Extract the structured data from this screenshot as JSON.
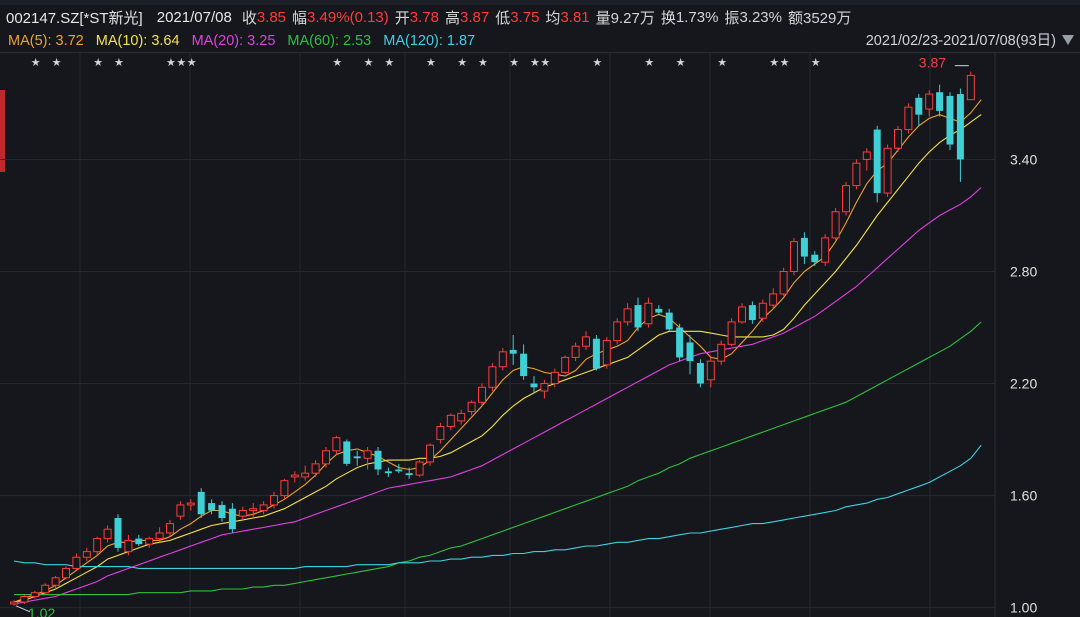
{
  "header": {
    "code_name": "002147.SZ[*ST新光]",
    "date": "2021/07/08",
    "close_label": "收",
    "close": "3.85",
    "change_label": "幅",
    "change": "3.49%(0.13)",
    "open_label": "开",
    "open": "3.78",
    "high_label": "高",
    "high": "3.87",
    "low_label": "低",
    "low": "3.75",
    "avg_label": "均",
    "avg": "3.81",
    "volume_label": "量",
    "volume": "9.27万",
    "turnover_label": "换",
    "turnover": "1.73%",
    "amplitude_label": "振",
    "amplitude": "3.23%",
    "amount_label": "额",
    "amount": "3529万"
  },
  "ma_legend": [
    {
      "text": "MA(5): 3.72",
      "color": "#f0a030"
    },
    {
      "text": "MA(10): 3.64",
      "color": "#f5e14a"
    },
    {
      "text": "MA(20): 3.25",
      "color": "#e040e0"
    },
    {
      "text": "MA(60): 2.53",
      "color": "#30c040"
    },
    {
      "text": "MA(120): 1.87",
      "color": "#40d0e0"
    }
  ],
  "date_range": "2021/02/23-2021/07/08(93日)",
  "chart_data": {
    "type": "candlestick",
    "ylim": [
      0.95,
      3.97
    ],
    "yticks": [
      "3.40",
      "2.80",
      "2.20",
      "1.60",
      "1.00"
    ],
    "ytick_values": [
      3.4,
      2.8,
      2.2,
      1.6,
      1.0
    ],
    "high_marker": "3.87",
    "low_marker": "1.02",
    "star_slots": [
      2,
      4,
      8,
      10,
      15,
      16,
      17,
      31,
      34,
      36,
      40,
      43,
      45,
      48,
      50,
      51,
      56,
      61,
      64,
      68,
      73,
      74,
      77
    ],
    "colors": {
      "up": "#ff3b3b",
      "down": "#3fd0d6"
    },
    "candles": [
      [
        1.02,
        1.04,
        1.01,
        1.03
      ],
      [
        1.03,
        1.07,
        1.02,
        1.06
      ],
      [
        1.06,
        1.09,
        1.05,
        1.08
      ],
      [
        1.08,
        1.13,
        1.07,
        1.12
      ],
      [
        1.12,
        1.17,
        1.1,
        1.16
      ],
      [
        1.16,
        1.22,
        1.15,
        1.21
      ],
      [
        1.21,
        1.29,
        1.2,
        1.27
      ],
      [
        1.27,
        1.32,
        1.25,
        1.3
      ],
      [
        1.3,
        1.38,
        1.28,
        1.37
      ],
      [
        1.37,
        1.44,
        1.35,
        1.42
      ],
      [
        1.48,
        1.5,
        1.3,
        1.32
      ],
      [
        1.3,
        1.39,
        1.28,
        1.36
      ],
      [
        1.37,
        1.39,
        1.33,
        1.34
      ],
      [
        1.34,
        1.38,
        1.32,
        1.37
      ],
      [
        1.37,
        1.43,
        1.35,
        1.4
      ],
      [
        1.4,
        1.47,
        1.38,
        1.45
      ],
      [
        1.49,
        1.57,
        1.47,
        1.55
      ],
      [
        1.55,
        1.58,
        1.52,
        1.56
      ],
      [
        1.62,
        1.64,
        1.48,
        1.5
      ],
      [
        1.56,
        1.58,
        1.5,
        1.52
      ],
      [
        1.55,
        1.57,
        1.46,
        1.48
      ],
      [
        1.53,
        1.56,
        1.4,
        1.42
      ],
      [
        1.49,
        1.54,
        1.47,
        1.52
      ],
      [
        1.52,
        1.56,
        1.48,
        1.53
      ],
      [
        1.52,
        1.57,
        1.5,
        1.55
      ],
      [
        1.55,
        1.62,
        1.53,
        1.6
      ],
      [
        1.6,
        1.69,
        1.58,
        1.68
      ],
      [
        1.7,
        1.73,
        1.67,
        1.71
      ],
      [
        1.7,
        1.76,
        1.68,
        1.72
      ],
      [
        1.72,
        1.79,
        1.7,
        1.77
      ],
      [
        1.77,
        1.86,
        1.75,
        1.84
      ],
      [
        1.84,
        1.92,
        1.82,
        1.91
      ],
      [
        1.89,
        1.9,
        1.76,
        1.77
      ],
      [
        1.81,
        1.84,
        1.76,
        1.8
      ],
      [
        1.8,
        1.86,
        1.74,
        1.84
      ],
      [
        1.84,
        1.86,
        1.71,
        1.74
      ],
      [
        1.73,
        1.75,
        1.7,
        1.72
      ],
      [
        1.74,
        1.77,
        1.72,
        1.73
      ],
      [
        1.72,
        1.75,
        1.69,
        1.71
      ],
      [
        1.71,
        1.79,
        1.7,
        1.78
      ],
      [
        1.78,
        1.88,
        1.76,
        1.87
      ],
      [
        1.9,
        1.99,
        1.88,
        1.97
      ],
      [
        1.97,
        2.04,
        1.95,
        2.03
      ],
      [
        2.0,
        2.06,
        1.98,
        2.04
      ],
      [
        2.05,
        2.11,
        2.03,
        2.1
      ],
      [
        2.1,
        2.2,
        2.08,
        2.18
      ],
      [
        2.18,
        2.31,
        2.16,
        2.29
      ],
      [
        2.29,
        2.39,
        2.27,
        2.37
      ],
      [
        2.38,
        2.46,
        2.3,
        2.36
      ],
      [
        2.36,
        2.41,
        2.22,
        2.24
      ],
      [
        2.2,
        2.24,
        2.15,
        2.18
      ],
      [
        2.16,
        2.22,
        2.12,
        2.2
      ],
      [
        2.2,
        2.28,
        2.18,
        2.26
      ],
      [
        2.26,
        2.35,
        2.25,
        2.34
      ],
      [
        2.34,
        2.42,
        2.32,
        2.4
      ],
      [
        2.4,
        2.48,
        2.38,
        2.45
      ],
      [
        2.44,
        2.46,
        2.27,
        2.28
      ],
      [
        2.3,
        2.45,
        2.28,
        2.43
      ],
      [
        2.43,
        2.55,
        2.41,
        2.53
      ],
      [
        2.53,
        2.63,
        2.51,
        2.6
      ],
      [
        2.62,
        2.66,
        2.48,
        2.5
      ],
      [
        2.52,
        2.66,
        2.5,
        2.63
      ],
      [
        2.6,
        2.62,
        2.57,
        2.58
      ],
      [
        2.58,
        2.6,
        2.48,
        2.49
      ],
      [
        2.5,
        2.52,
        2.32,
        2.34
      ],
      [
        2.42,
        2.46,
        2.25,
        2.32
      ],
      [
        2.31,
        2.33,
        2.18,
        2.2
      ],
      [
        2.22,
        2.35,
        2.18,
        2.32
      ],
      [
        2.32,
        2.43,
        2.3,
        2.41
      ],
      [
        2.41,
        2.55,
        2.4,
        2.53
      ],
      [
        2.53,
        2.63,
        2.52,
        2.61
      ],
      [
        2.62,
        2.64,
        2.52,
        2.54
      ],
      [
        2.55,
        2.65,
        2.53,
        2.63
      ],
      [
        2.62,
        2.71,
        2.6,
        2.68
      ],
      [
        2.68,
        2.82,
        2.67,
        2.8
      ],
      [
        2.8,
        2.98,
        2.78,
        2.96
      ],
      [
        2.98,
        3.01,
        2.84,
        2.88
      ],
      [
        2.89,
        2.91,
        2.83,
        2.85
      ],
      [
        2.85,
        3.0,
        2.83,
        2.98
      ],
      [
        2.98,
        3.14,
        2.97,
        3.12
      ],
      [
        3.12,
        3.28,
        3.1,
        3.26
      ],
      [
        3.26,
        3.4,
        3.24,
        3.38
      ],
      [
        3.4,
        3.46,
        3.34,
        3.44
      ],
      [
        3.56,
        3.58,
        3.17,
        3.22
      ],
      [
        3.22,
        3.48,
        3.2,
        3.46
      ],
      [
        3.46,
        3.58,
        3.44,
        3.56
      ],
      [
        3.56,
        3.7,
        3.54,
        3.68
      ],
      [
        3.73,
        3.75,
        3.58,
        3.64
      ],
      [
        3.67,
        3.77,
        3.63,
        3.75
      ],
      [
        3.76,
        3.8,
        3.63,
        3.66
      ],
      [
        3.74,
        3.76,
        3.45,
        3.48
      ],
      [
        3.75,
        3.78,
        3.28,
        3.4
      ],
      [
        3.72,
        3.87,
        3.75,
        3.85
      ]
    ],
    "ma_series": [
      {
        "name": "MA(5)",
        "color": "#f0a030",
        "values": [
          1.03,
          1.05,
          1.07,
          1.09,
          1.12,
          1.16,
          1.2,
          1.24,
          1.28,
          1.33,
          1.35,
          1.35,
          1.36,
          1.36,
          1.36,
          1.38,
          1.42,
          1.45,
          1.49,
          1.52,
          1.52,
          1.5,
          1.49,
          1.5,
          1.52,
          1.55,
          1.58,
          1.62,
          1.66,
          1.71,
          1.77,
          1.82,
          1.84,
          1.85,
          1.83,
          1.81,
          1.78,
          1.75,
          1.74,
          1.75,
          1.79,
          1.84,
          1.9,
          1.96,
          2.02,
          2.08,
          2.15,
          2.22,
          2.27,
          2.29,
          2.28,
          2.26,
          2.25,
          2.24,
          2.27,
          2.33,
          2.36,
          2.38,
          2.4,
          2.43,
          2.5,
          2.55,
          2.57,
          2.55,
          2.5,
          2.45,
          2.4,
          2.34,
          2.33,
          2.36,
          2.42,
          2.48,
          2.55,
          2.6,
          2.66,
          2.74,
          2.8,
          2.84,
          2.88,
          2.96,
          3.06,
          3.17,
          3.27,
          3.34,
          3.38,
          3.45,
          3.52,
          3.58,
          3.62,
          3.64,
          3.62,
          3.6,
          3.65,
          3.72
        ]
      },
      {
        "name": "MA(10)",
        "color": "#f5e14a",
        "values": [
          1.03,
          1.04,
          1.06,
          1.08,
          1.1,
          1.13,
          1.16,
          1.19,
          1.22,
          1.26,
          1.28,
          1.3,
          1.32,
          1.34,
          1.35,
          1.36,
          1.38,
          1.4,
          1.42,
          1.44,
          1.45,
          1.46,
          1.47,
          1.48,
          1.49,
          1.51,
          1.53,
          1.56,
          1.59,
          1.62,
          1.65,
          1.69,
          1.72,
          1.75,
          1.77,
          1.78,
          1.79,
          1.79,
          1.79,
          1.8,
          1.8,
          1.81,
          1.83,
          1.86,
          1.89,
          1.92,
          1.97,
          2.03,
          2.08,
          2.12,
          2.15,
          2.18,
          2.2,
          2.22,
          2.24,
          2.26,
          2.28,
          2.3,
          2.32,
          2.34,
          2.38,
          2.42,
          2.46,
          2.48,
          2.48,
          2.48,
          2.48,
          2.47,
          2.46,
          2.45,
          2.45,
          2.45,
          2.45,
          2.46,
          2.49,
          2.55,
          2.62,
          2.68,
          2.74,
          2.8,
          2.87,
          2.94,
          3.02,
          3.1,
          3.17,
          3.24,
          3.31,
          3.38,
          3.44,
          3.49,
          3.53,
          3.56,
          3.6,
          3.64
        ]
      },
      {
        "name": "MA(20)",
        "color": "#e040e0",
        "values": [
          1.02,
          1.03,
          1.04,
          1.05,
          1.06,
          1.08,
          1.1,
          1.12,
          1.14,
          1.17,
          1.19,
          1.21,
          1.23,
          1.25,
          1.27,
          1.29,
          1.31,
          1.33,
          1.35,
          1.37,
          1.39,
          1.4,
          1.41,
          1.42,
          1.43,
          1.44,
          1.45,
          1.46,
          1.48,
          1.5,
          1.52,
          1.54,
          1.56,
          1.58,
          1.6,
          1.62,
          1.64,
          1.65,
          1.66,
          1.67,
          1.68,
          1.69,
          1.7,
          1.72,
          1.74,
          1.76,
          1.79,
          1.82,
          1.85,
          1.88,
          1.91,
          1.94,
          1.97,
          2.0,
          2.03,
          2.06,
          2.09,
          2.12,
          2.15,
          2.18,
          2.21,
          2.24,
          2.27,
          2.3,
          2.32,
          2.34,
          2.36,
          2.37,
          2.38,
          2.39,
          2.4,
          2.41,
          2.43,
          2.45,
          2.47,
          2.5,
          2.53,
          2.56,
          2.6,
          2.64,
          2.68,
          2.72,
          2.77,
          2.82,
          2.87,
          2.92,
          2.97,
          3.02,
          3.06,
          3.1,
          3.13,
          3.16,
          3.2,
          3.25
        ]
      },
      {
        "name": "MA(60)",
        "color": "#30c040",
        "values": [
          1.07,
          1.07,
          1.07,
          1.07,
          1.07,
          1.07,
          1.07,
          1.07,
          1.07,
          1.07,
          1.07,
          1.07,
          1.08,
          1.08,
          1.08,
          1.08,
          1.08,
          1.09,
          1.09,
          1.09,
          1.1,
          1.1,
          1.1,
          1.11,
          1.11,
          1.12,
          1.12,
          1.13,
          1.14,
          1.15,
          1.16,
          1.17,
          1.18,
          1.19,
          1.2,
          1.21,
          1.22,
          1.24,
          1.25,
          1.27,
          1.28,
          1.3,
          1.32,
          1.33,
          1.35,
          1.37,
          1.39,
          1.41,
          1.43,
          1.45,
          1.47,
          1.49,
          1.51,
          1.53,
          1.55,
          1.57,
          1.59,
          1.61,
          1.63,
          1.65,
          1.68,
          1.7,
          1.72,
          1.75,
          1.77,
          1.8,
          1.82,
          1.84,
          1.86,
          1.88,
          1.9,
          1.92,
          1.94,
          1.96,
          1.98,
          2.0,
          2.02,
          2.04,
          2.06,
          2.08,
          2.1,
          2.13,
          2.16,
          2.19,
          2.22,
          2.25,
          2.28,
          2.31,
          2.34,
          2.37,
          2.4,
          2.44,
          2.48,
          2.53
        ]
      },
      {
        "name": "MA(120)",
        "color": "#40d0e0",
        "values": [
          1.25,
          1.24,
          1.24,
          1.23,
          1.23,
          1.23,
          1.22,
          1.22,
          1.22,
          1.22,
          1.22,
          1.22,
          1.21,
          1.21,
          1.21,
          1.21,
          1.21,
          1.21,
          1.21,
          1.21,
          1.21,
          1.21,
          1.21,
          1.21,
          1.21,
          1.21,
          1.21,
          1.21,
          1.22,
          1.22,
          1.22,
          1.22,
          1.22,
          1.23,
          1.23,
          1.23,
          1.23,
          1.24,
          1.24,
          1.24,
          1.25,
          1.25,
          1.26,
          1.26,
          1.27,
          1.27,
          1.28,
          1.28,
          1.29,
          1.29,
          1.3,
          1.3,
          1.31,
          1.31,
          1.32,
          1.33,
          1.33,
          1.34,
          1.35,
          1.35,
          1.36,
          1.37,
          1.37,
          1.38,
          1.39,
          1.4,
          1.4,
          1.41,
          1.42,
          1.43,
          1.44,
          1.45,
          1.45,
          1.46,
          1.47,
          1.48,
          1.49,
          1.5,
          1.51,
          1.52,
          1.54,
          1.55,
          1.56,
          1.58,
          1.59,
          1.61,
          1.63,
          1.65,
          1.67,
          1.7,
          1.73,
          1.76,
          1.8,
          1.87
        ]
      }
    ]
  }
}
